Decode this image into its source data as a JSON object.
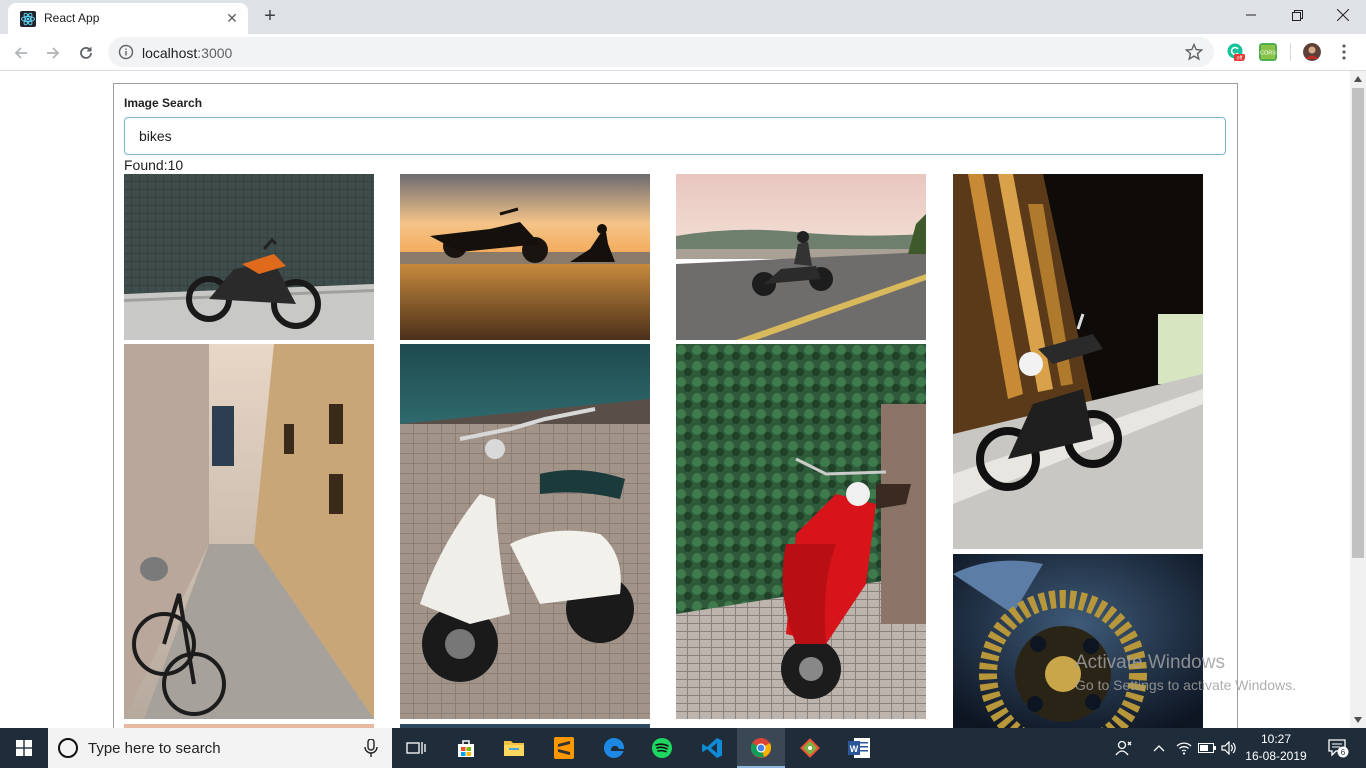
{
  "browser": {
    "tab_title": "React App",
    "url_host": "localhost",
    "url_port": ":3000"
  },
  "app": {
    "search_label": "Image Search",
    "search_value": "bikes",
    "found_prefix": "Found:",
    "found_count": "10"
  },
  "images": [
    {
      "name": "orange-motorcycle-against-tiled-wall"
    },
    {
      "name": "motorcycle-silhouette-sunset-seated-person"
    },
    {
      "name": "rider-on-motorcycle-on-highway"
    },
    {
      "name": "motorcycle-in-wooden-covered-bridge"
    },
    {
      "name": "bicycle-in-narrow-alley"
    },
    {
      "name": "white-vespa-scooter"
    },
    {
      "name": "red-vespa-scooter-by-ivy-wall"
    },
    {
      "name": "bike-chain-closeup"
    },
    {
      "name": "partial-image-row3-col1"
    },
    {
      "name": "partial-image-row3-col2"
    }
  ],
  "overlay": {
    "watermark_title": "Activate Windows",
    "watermark_sub": "Go to Settings to activate Windows."
  },
  "taskbar": {
    "search_placeholder": "Type here to search",
    "time": "10:27",
    "date": "16-08-2019",
    "notifications": "6"
  },
  "colors": {
    "taskbar_bg": "#1f2d3a",
    "input_border": "#7fb3c9",
    "card_border": "#9e9e9e"
  }
}
